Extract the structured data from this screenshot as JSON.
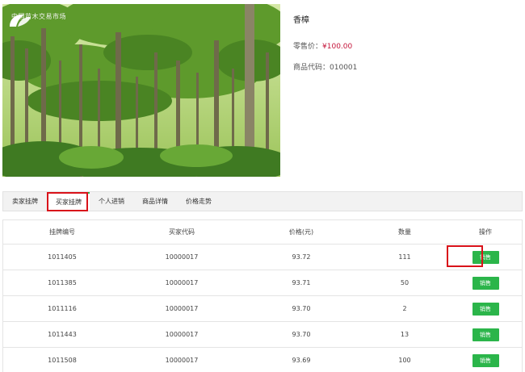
{
  "product": {
    "logo_text": "中国苗木交易市场",
    "name": "香樟",
    "retail_label": "零售价：",
    "retail_price": "¥100.00",
    "code_label": "商品代码：",
    "code_value": "010001"
  },
  "tabs": [
    {
      "label": "卖家挂牌",
      "active": false
    },
    {
      "label": "买家挂牌",
      "active": true
    },
    {
      "label": "个人进销",
      "active": false
    },
    {
      "label": "商品详情",
      "active": false
    },
    {
      "label": "价格走势",
      "active": false
    }
  ],
  "table": {
    "headers": [
      "挂牌编号",
      "买家代码",
      "价格(元)",
      "数量",
      "操作"
    ],
    "rows": [
      {
        "id": "1011405",
        "buyer": "10000017",
        "price": "93.72",
        "qty": "111",
        "action": "销售"
      },
      {
        "id": "1011385",
        "buyer": "10000017",
        "price": "93.71",
        "qty": "50",
        "action": "销售"
      },
      {
        "id": "1011116",
        "buyer": "10000017",
        "price": "93.70",
        "qty": "2",
        "action": "销售"
      },
      {
        "id": "1011443",
        "buyer": "10000017",
        "price": "93.70",
        "qty": "13",
        "action": "销售"
      },
      {
        "id": "1011508",
        "buyer": "10000017",
        "price": "93.69",
        "qty": "100",
        "action": "销售"
      }
    ]
  },
  "colors": {
    "accent": "#2bb54a",
    "price": "#c4143a",
    "highlight": "#d9121a"
  }
}
